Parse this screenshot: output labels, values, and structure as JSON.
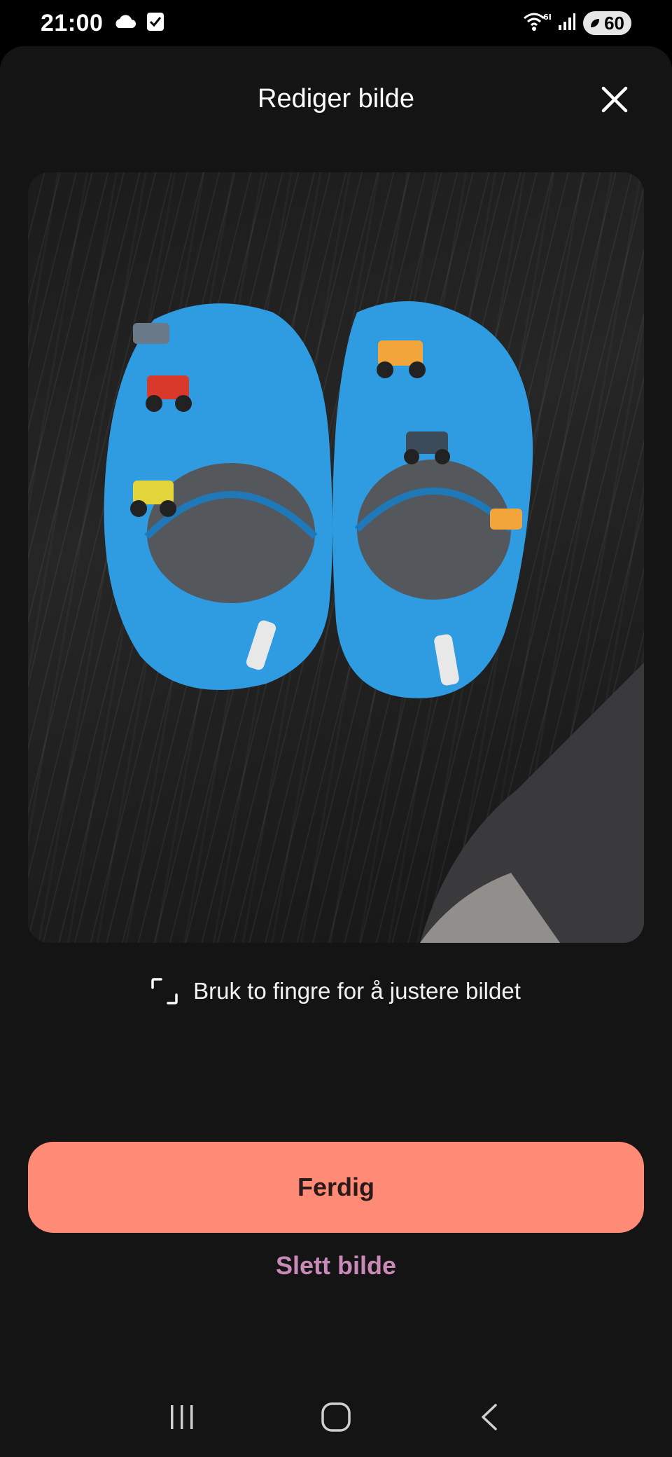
{
  "status_bar": {
    "time": "21:00",
    "icons": [
      "cloud-icon",
      "checkbox-icon",
      "wifi-icon",
      "signal-icon"
    ],
    "network_label": "6E",
    "battery": "60"
  },
  "header": {
    "title": "Rediger bilde",
    "close_icon": "close-icon"
  },
  "photo": {
    "description_icon": "photo-preview"
  },
  "hint": {
    "icon": "crop-frame-icon",
    "text": "Bruk to fingre for å justere bildet"
  },
  "actions": {
    "done_label": "Ferdig",
    "delete_label": "Slett bilde"
  },
  "nav": {
    "icons": [
      "recent-apps-icon",
      "home-icon",
      "back-icon"
    ]
  },
  "colors": {
    "background": "#141414",
    "primary_button": "#ff8a75",
    "secondary_text": "#c98ab8"
  }
}
